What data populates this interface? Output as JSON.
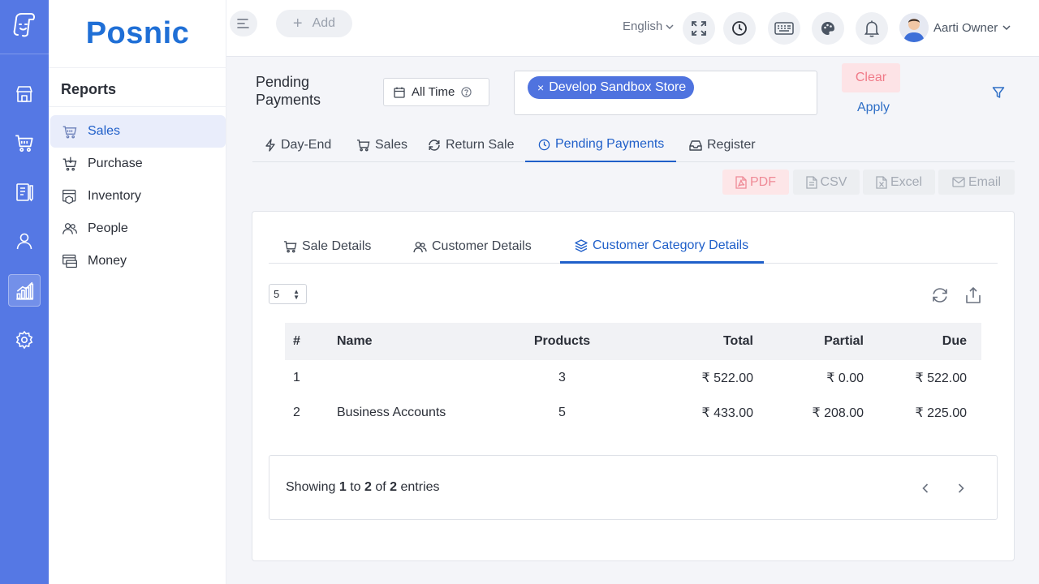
{
  "app": {
    "brand": "Posnic",
    "accent": "#5578e4",
    "primary_text": "#1f5fc9"
  },
  "rail": {
    "items": [
      {
        "icon": "logo-icon"
      },
      {
        "icon": "store-icon"
      },
      {
        "icon": "cart-icon"
      },
      {
        "icon": "clipboard-icon"
      },
      {
        "icon": "user-icon"
      },
      {
        "icon": "chart-icon",
        "active": true
      },
      {
        "icon": "gear-icon"
      }
    ]
  },
  "sidemenu": {
    "title": "Reports",
    "items": [
      {
        "label": "Sales",
        "icon": "basket-icon",
        "active": true
      },
      {
        "label": "Purchase",
        "icon": "purchase-icon"
      },
      {
        "label": "Inventory",
        "icon": "inventory-icon"
      },
      {
        "label": "People",
        "icon": "people-icon"
      },
      {
        "label": "Money",
        "icon": "money-icon"
      }
    ]
  },
  "topbar": {
    "add_label": "Add",
    "language": "English",
    "user_name": "Aarti Owner"
  },
  "filter": {
    "page_title": "Pending Payments",
    "time_range": "All Time",
    "store_chip": "Develop Sandbox Store",
    "clear_label": "Clear",
    "apply_label": "Apply"
  },
  "report_tabs": [
    {
      "label": "Day-End",
      "icon": "bolt-icon"
    },
    {
      "label": "Sales",
      "icon": "cart-icon"
    },
    {
      "label": "Return Sale",
      "icon": "refresh-icon"
    },
    {
      "label": "Pending Payments",
      "icon": "clock-icon",
      "active": true
    },
    {
      "label": "Register",
      "icon": "inbox-icon"
    }
  ],
  "export": {
    "pdf": "PDF",
    "csv": "CSV",
    "excel": "Excel",
    "email": "Email"
  },
  "card_tabs": [
    {
      "label": "Sale Details",
      "icon": "cart-icon"
    },
    {
      "label": "Customer Details",
      "icon": "users-icon"
    },
    {
      "label": "Customer Category Details",
      "icon": "layers-icon",
      "active": true
    }
  ],
  "table": {
    "page_size": "5",
    "columns": {
      "idx": "#",
      "name": "Name",
      "products": "Products",
      "total": "Total",
      "partial": "Partial",
      "due": "Due"
    },
    "rows": [
      {
        "idx": "1",
        "name": "",
        "products": "3",
        "total": "₹ 522.00",
        "partial": "₹ 0.00",
        "due": "₹ 522.00"
      },
      {
        "idx": "2",
        "name": "Business Accounts",
        "products": "5",
        "total": "₹ 433.00",
        "partial": "₹ 208.00",
        "due": "₹ 225.00"
      }
    ]
  },
  "pagination": {
    "prefix": "Showing",
    "from": "1",
    "to_word": "to",
    "to": "2",
    "of_word": "of",
    "total": "2",
    "suffix": "entries"
  }
}
